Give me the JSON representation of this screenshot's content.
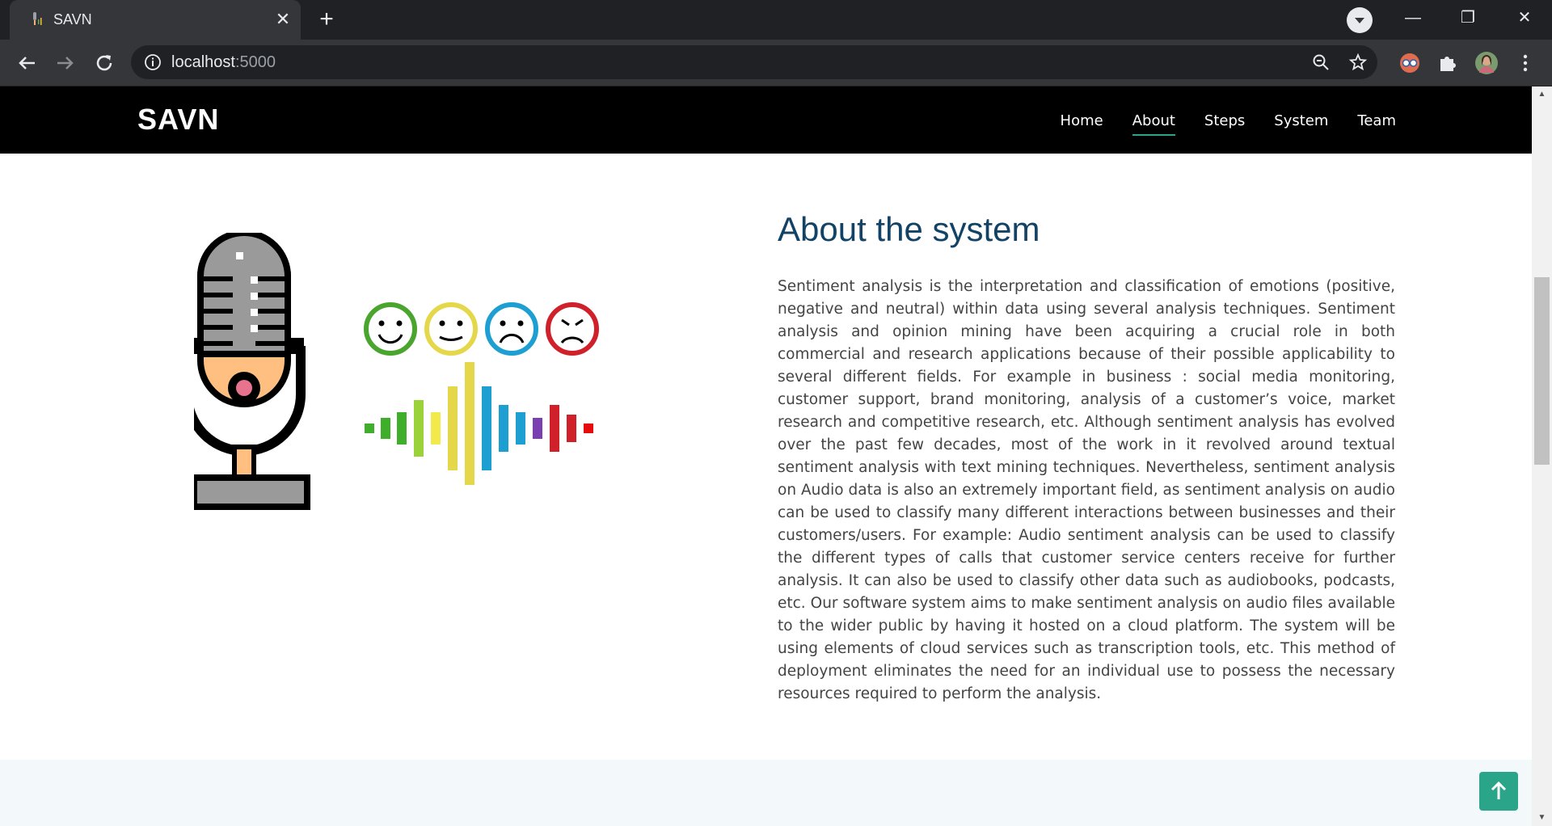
{
  "browser": {
    "tab_title": "SAVN",
    "tab_close": "✕",
    "new_tab": "+",
    "url_host": "localhost",
    "url_port": ":5000",
    "window_minimize": "—",
    "window_restore": "❐",
    "window_close": "✕"
  },
  "site": {
    "logo": "SAVN",
    "nav": [
      {
        "label": "Home"
      },
      {
        "label": "About"
      },
      {
        "label": "Steps"
      },
      {
        "label": "System"
      },
      {
        "label": "Team"
      }
    ]
  },
  "about": {
    "title": "About the system",
    "body": "Sentiment analysis is the interpretation and classification of emotions (positive, negative and neutral) within data using several analysis techniques. Sentiment analysis and opinion mining have been acquiring a crucial role in both commercial and research applications because of their possible applicability to several different fields. For example in business : social media monitoring, customer support, brand monitoring, analysis of a customer’s voice, market research and competitive research, etc. Although sentiment analysis has evolved over the past few decades, most of the work in it revolved around textual sentiment analysis with text mining techniques. Nevertheless, sentiment analysis on Audio data is also an extremely important field, as sentiment analysis on audio can be used to classify many different interactions between businesses and their customers/users. For example: Audio sentiment analysis can be used to classify the different types of calls that customer service centers receive for further analysis. It can also be used to classify other data such as audiobooks, podcasts, etc. Our software system aims to make sentiment analysis on audio files available to the wider public by having it hosted on a cloud platform. The system will be using elements of cloud services such as transcription tools, etc. This method of deployment eliminates the need for an individual use to possess the necessary resources required to perform the analysis."
  },
  "colors": {
    "accent": "#2aa58a",
    "title": "#124265",
    "header_bg": "#000000",
    "section_alt_bg": "#f3f8fa"
  },
  "icons": {
    "back_to_top": "arrow-up-icon",
    "illustration": "microphone-emotions-icon"
  }
}
